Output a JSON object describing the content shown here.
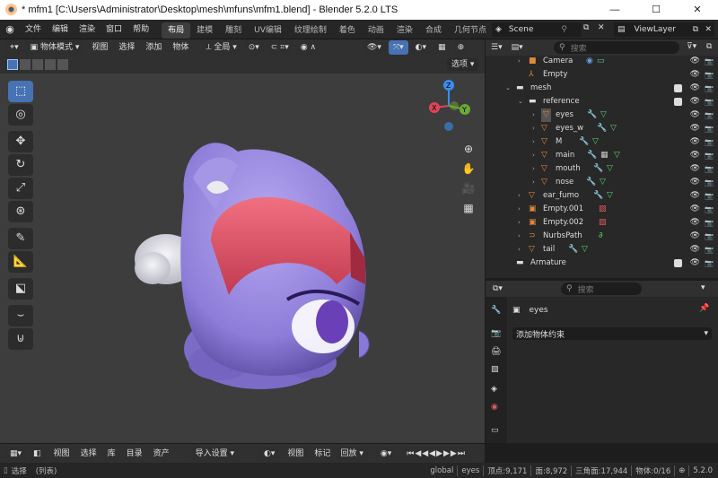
{
  "window": {
    "title": "* mfm1 [C:\\Users\\Administrator\\Desktop\\mesh\\mfuns\\mfm1.blend] - Blender 5.2.0 LTS",
    "minimize": "—",
    "maximize": "☐",
    "close": "✕"
  },
  "menubar": {
    "menus": [
      "文件",
      "编辑",
      "渲染",
      "窗口",
      "帮助"
    ],
    "tabs": [
      "布局",
      "建模",
      "雕刻",
      "UV编辑",
      "纹理绘制",
      "着色",
      "动画",
      "渲染",
      "合成",
      "几何节点"
    ],
    "scene": "Scene",
    "view_layer": "ViewLayer"
  },
  "viewport_header": {
    "mode": "物体模式",
    "menus": [
      "视图",
      "选择",
      "添加",
      "物体"
    ],
    "transform": "全局",
    "options": "选项"
  },
  "outliner": {
    "search_placeholder": "搜索",
    "rows": [
      {
        "label": "Camera"
      },
      {
        "label": "Empty"
      },
      {
        "label": "mesh"
      },
      {
        "label": "reference"
      },
      {
        "label": "eyes"
      },
      {
        "label": "eyes_w"
      },
      {
        "label": "M"
      },
      {
        "label": "main"
      },
      {
        "label": "mouth"
      },
      {
        "label": "nose"
      },
      {
        "label": "ear_fumo"
      },
      {
        "label": "Empty.001"
      },
      {
        "label": "Empty.002"
      },
      {
        "label": "NurbsPath"
      },
      {
        "label": "tail"
      },
      {
        "label": "Armature"
      }
    ]
  },
  "properties": {
    "search_placeholder": "搜索",
    "object_name": "eyes",
    "add_constraint": "添加物体约束"
  },
  "timeline": {
    "menus": [
      "视图",
      "选择",
      "库",
      "目录",
      "资产"
    ],
    "import": "导入设置",
    "menus2": [
      "视图",
      "标记"
    ],
    "playback": "回放"
  },
  "status": {
    "left": "选择",
    "left2": "(列表)",
    "context": "global",
    "object": "eyes",
    "verts": "顶点:9,171",
    "faces": "面:8,972",
    "tris": "三角面:17,944",
    "objects": "物体:0/16",
    "version": "5.2.0"
  }
}
